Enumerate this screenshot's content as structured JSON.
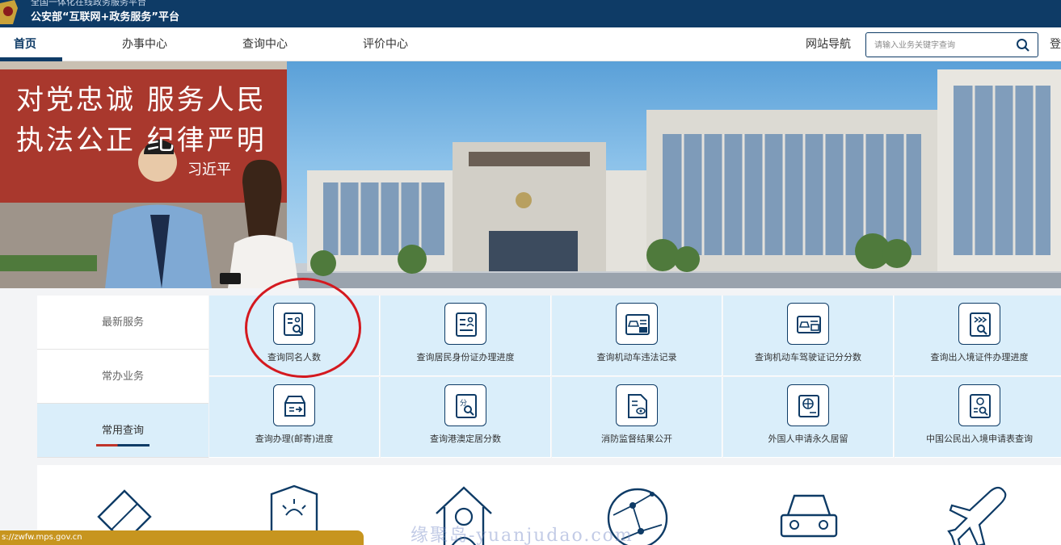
{
  "header": {
    "subtitle": "全国一体化在线政务服务平台",
    "title": "公安部“互联网+政务服务”平台"
  },
  "nav": {
    "items": [
      "首页",
      "办事中心",
      "查询中心",
      "评价中心"
    ],
    "site_nav": "网站导航",
    "login": "登",
    "search_placeholder": "请输入业务关键字查询"
  },
  "banner": {
    "slogan_line1": "对党忠诚 服务人民",
    "slogan_line2": "执法公正 纪律严明",
    "signature": "习近平"
  },
  "tabs": [
    "最新服务",
    "常办业务",
    "常用查询"
  ],
  "services": [
    {
      "label": "查询同名人数",
      "icon": "name-search-icon"
    },
    {
      "label": "查询居民身份证办理进度",
      "icon": "id-card-icon"
    },
    {
      "label": "查询机动车违法记录",
      "icon": "car-violation-icon"
    },
    {
      "label": "查询机动车驾驶证记分分数",
      "icon": "license-points-icon"
    },
    {
      "label": "查询出入境证件办理进度",
      "icon": "exit-entry-icon"
    },
    {
      "label": "查询办理(邮寄)进度",
      "icon": "mail-progress-icon"
    },
    {
      "label": "查询港澳定居分数",
      "icon": "hk-macau-score-icon"
    },
    {
      "label": "消防监督结果公开",
      "icon": "fire-supervision-icon"
    },
    {
      "label": "外国人申请永久居留",
      "icon": "foreigner-residence-icon"
    },
    {
      "label": "中国公民出入境申请表查询",
      "icon": "application-form-icon"
    }
  ],
  "features": [
    "passport-icon",
    "police-shield-icon",
    "household-icon",
    "network-globe-icon",
    "car-icon",
    "airplane-icon"
  ],
  "status_url": "s://zwfw.mps.gov.cn",
  "watermark": "缘聚岛-yuanjudao.com",
  "colors": {
    "primary": "#0e3b66",
    "accent_red": "#d4191f",
    "cell_bg": "#daeefa"
  }
}
